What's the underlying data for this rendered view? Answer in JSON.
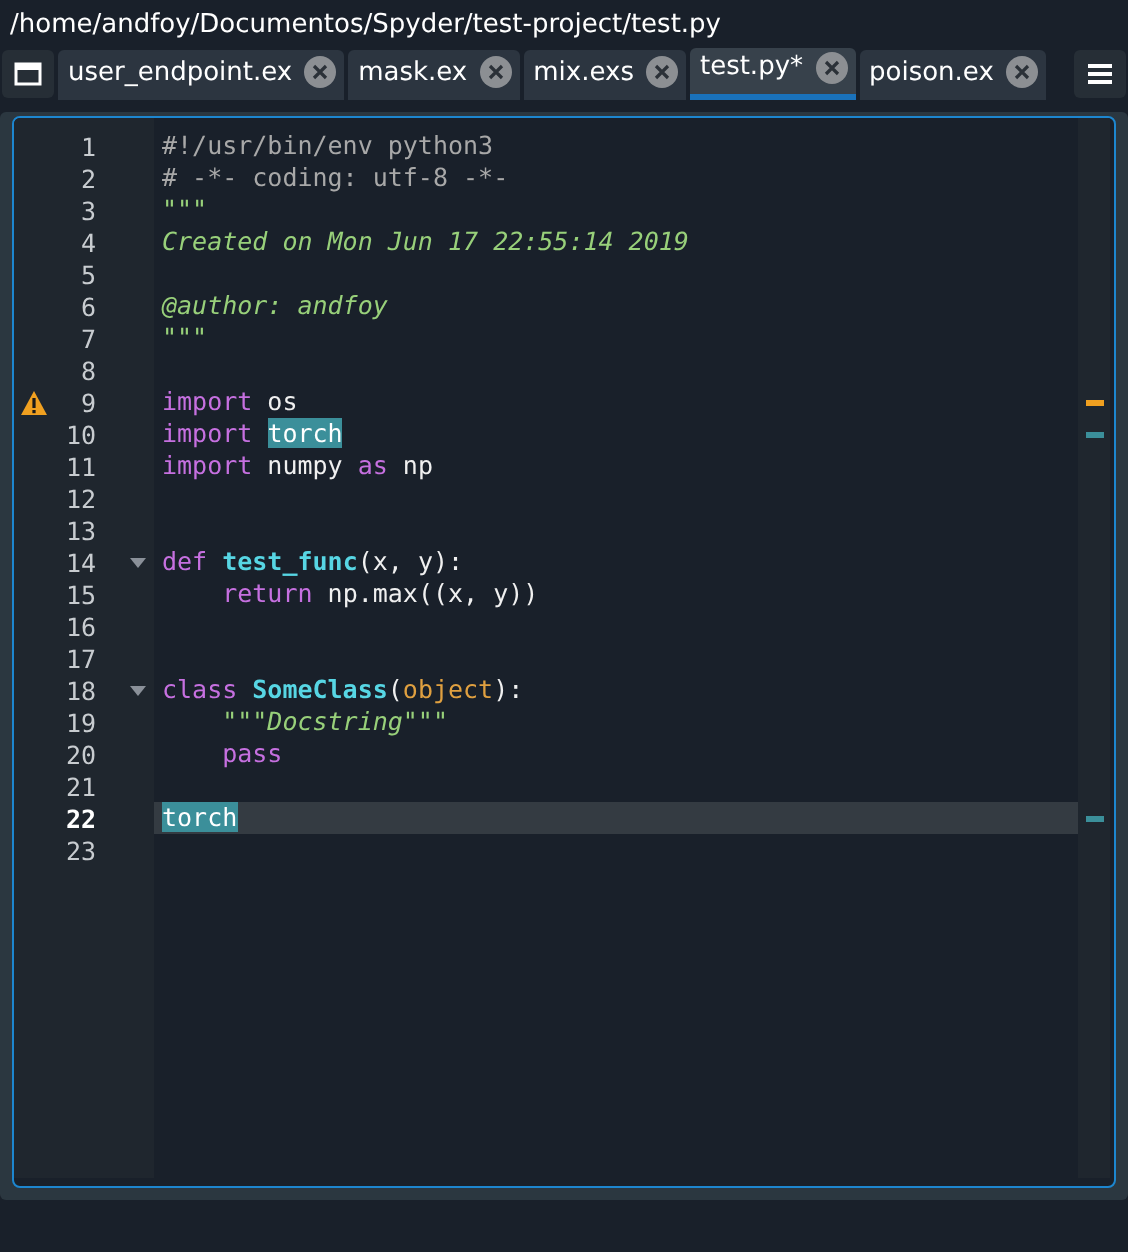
{
  "path": "/home/andfoy/Documentos/Spyder/test-project/test.py",
  "tabs": [
    {
      "label": "user_endpoint.ex",
      "selected": false
    },
    {
      "label": "mask.ex",
      "selected": false
    },
    {
      "label": "mix.exs",
      "selected": false
    },
    {
      "label": "test.py*",
      "selected": true
    },
    {
      "label": "poison.ex",
      "selected": false
    }
  ],
  "lines": [
    {
      "number": "1",
      "tokens": [
        {
          "kind": "comment",
          "text": "#!/usr/bin/env python3"
        }
      ]
    },
    {
      "number": "2",
      "tokens": [
        {
          "kind": "comment",
          "text": "# -*- coding: utf-8 -*-"
        }
      ]
    },
    {
      "number": "3",
      "tokens": [
        {
          "kind": "docstring",
          "text": "\"\"\""
        }
      ]
    },
    {
      "number": "4",
      "tokens": [
        {
          "kind": "docstring",
          "text": "Created on Mon Jun 17 22:55:14 2019"
        }
      ]
    },
    {
      "number": "5"
    },
    {
      "number": "6",
      "tokens": [
        {
          "kind": "docstring",
          "text": "@author: andfoy"
        }
      ]
    },
    {
      "number": "7",
      "tokens": [
        {
          "kind": "docstring",
          "text": "\"\"\""
        }
      ]
    },
    {
      "number": "8"
    },
    {
      "number": "9",
      "warning": true,
      "tokens": [
        {
          "kind": "keyword",
          "text": "import"
        },
        {
          "kind": "plain",
          "text": " os"
        }
      ]
    },
    {
      "number": "10",
      "occurrence": true,
      "tokens": [
        {
          "kind": "keyword",
          "text": "import "
        },
        {
          "kind": "highlight",
          "text": "torch"
        }
      ]
    },
    {
      "number": "11",
      "tokens": [
        {
          "kind": "keyword",
          "text": "import"
        },
        {
          "kind": "plain",
          "text": " numpy "
        },
        {
          "kind": "keyword",
          "text": "as"
        },
        {
          "kind": "plain",
          "text": " np"
        }
      ]
    },
    {
      "number": "12"
    },
    {
      "number": "13"
    },
    {
      "number": "14",
      "foldable": true,
      "tokens": [
        {
          "kind": "keyword",
          "text": "def "
        },
        {
          "kind": "name",
          "text": "test_func"
        },
        {
          "kind": "plain",
          "text": "(x, y):"
        }
      ]
    },
    {
      "number": "15",
      "tokens": [
        {
          "kind": "keyword",
          "text": "    return"
        },
        {
          "kind": "plain",
          "text": " np.max((x, y))"
        }
      ]
    },
    {
      "number": "16"
    },
    {
      "number": "17"
    },
    {
      "number": "18",
      "foldable": true,
      "tokens": [
        {
          "kind": "keyword",
          "text": "class "
        },
        {
          "kind": "name",
          "text": "SomeClass"
        },
        {
          "kind": "plain",
          "text": "("
        },
        {
          "kind": "builtin",
          "text": "object"
        },
        {
          "kind": "plain",
          "text": "):"
        }
      ]
    },
    {
      "number": "19",
      "tokens": [
        {
          "kind": "docstring",
          "text": "    \"\"\"Docstring\"\"\""
        }
      ]
    },
    {
      "number": "20",
      "tokens": [
        {
          "kind": "keyword",
          "text": "    pass"
        }
      ]
    },
    {
      "number": "21"
    },
    {
      "number": "22",
      "current": true,
      "occurrence": true,
      "tokens": [
        {
          "kind": "highlight",
          "text": "torch"
        }
      ]
    },
    {
      "number": "23"
    }
  ]
}
